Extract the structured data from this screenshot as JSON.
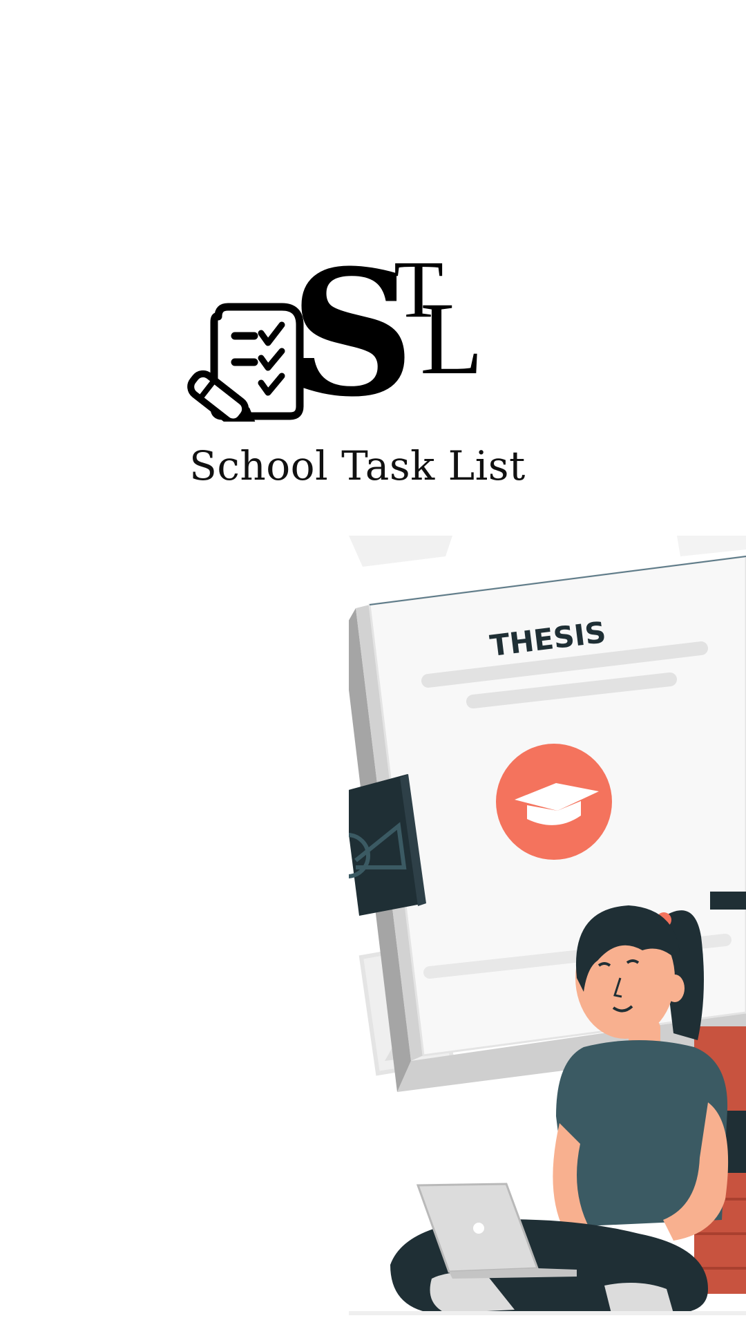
{
  "splash": {
    "logo": {
      "monogram_s": "S",
      "monogram_t": "T",
      "monogram_l": "L",
      "icon": "checklist-pencil-icon"
    },
    "app_title": "School Task List",
    "illustration": {
      "document_label": "THESIS",
      "icon": "graduation-cap-icon",
      "subject": "student-with-laptop"
    }
  },
  "colors": {
    "background": "#ffffff",
    "logo_ink": "#000000",
    "accent_coral": "#f4735d",
    "dark_teal": "#1f2f35",
    "shirt": "#3b5a63",
    "brick": "#c8533f"
  }
}
